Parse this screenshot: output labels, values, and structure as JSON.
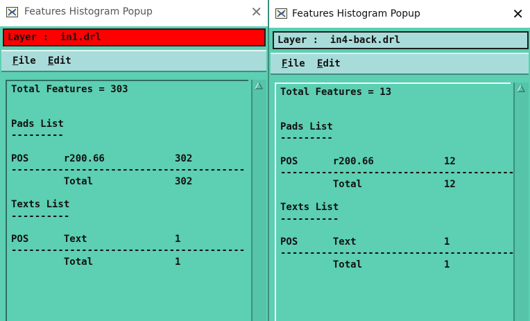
{
  "windows": [
    {
      "title": "Features Histogram Popup",
      "close_glyph": "✕",
      "layer_bar": "Layer :  in1.drl",
      "layer_bar_color": "#ff0000",
      "menu": [
        {
          "mnemonic": "F",
          "rest": "ile"
        },
        {
          "mnemonic": "E",
          "rest": "dit"
        }
      ],
      "report": "Total Features = 303\n\n\nPads List\n---------\n\nPOS      r200.66            302\n----------------------------------------\n         Total              302\n\nTexts List\n----------\n\nPOS      Text               1\n----------------------------------------\n         Total              1"
    },
    {
      "title": "Features Histogram Popup",
      "close_glyph": "✕",
      "layer_bar": "Layer :  in4-back.drl",
      "layer_bar_color": "#a8dcda",
      "menu": [
        {
          "mnemonic": "F",
          "rest": "ile"
        },
        {
          "mnemonic": "E",
          "rest": "dit"
        }
      ],
      "report": "Total Features = 13\n\n\nPads List\n---------\n\nPOS      r200.66            12\n----------------------------------------\n         Total              12\n\nTexts List\n----------\n\nPOS      Text               1\n----------------------------------------\n         Total              1"
    }
  ],
  "colors": {
    "window_background": "#5dcfb2",
    "menubar": "#a8dcda",
    "scrollbar": "#55c4a9"
  },
  "icons": {
    "app": "features-histogram-app-icon",
    "close": "close-icon",
    "scroll_up": "scroll-up-arrow-icon"
  }
}
